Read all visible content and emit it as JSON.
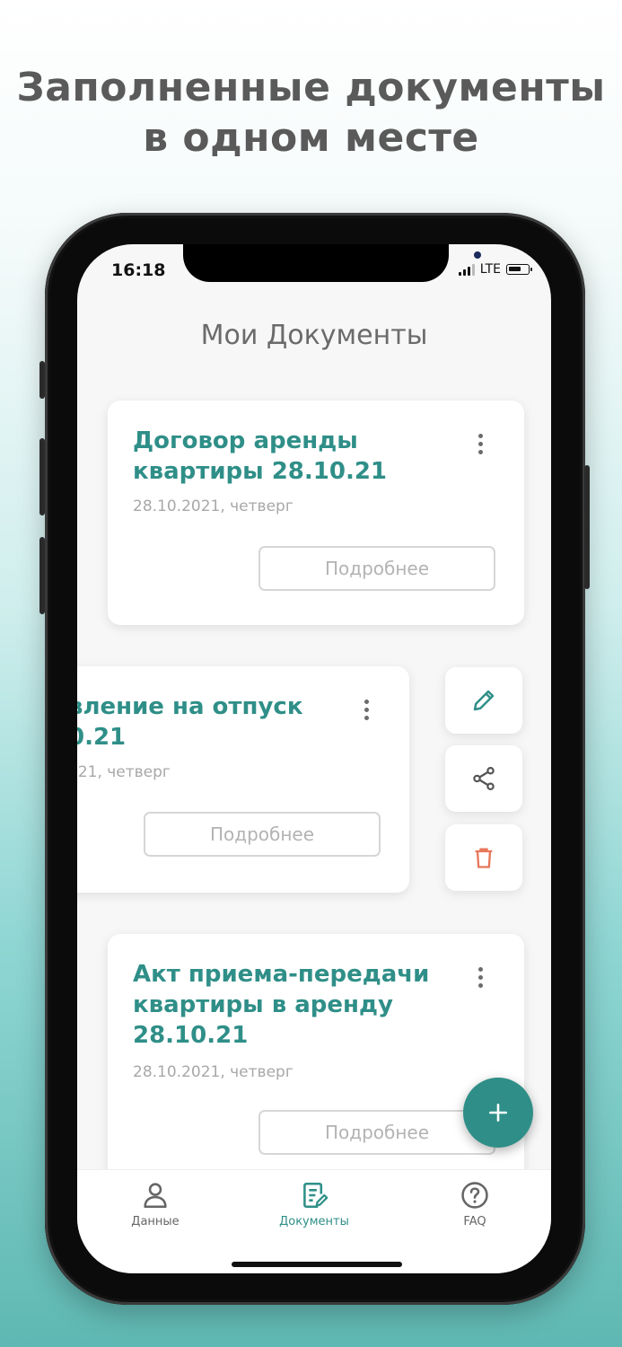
{
  "headline": {
    "line1": "Заполненные документы",
    "line2": "в одном месте"
  },
  "status_bar": {
    "time": "16:18",
    "network": "LTE"
  },
  "page_title": "Мои Документы",
  "documents": [
    {
      "title_line1": "Договор аренды",
      "title_line2": "квартиры 28.10.21",
      "date": "28.10.2021, четверг",
      "button": "Подробнее"
    },
    {
      "title_line1": "вление на отпуск",
      "title_line2": "0.21",
      "date": "021, четверг",
      "button": "Подробнее"
    },
    {
      "title_line1": "Акт приема-передачи",
      "title_line2": "квартиры в аренду",
      "title_line3": "28.10.21",
      "date": "28.10.2021, четверг",
      "button": "Подробнее"
    }
  ],
  "swipe_actions": {
    "icons": [
      "pencil-icon",
      "share-icon",
      "trash-icon"
    ],
    "delete_color": "#e8775a"
  },
  "fab": {
    "icon": "plus-icon"
  },
  "tabbar": {
    "items": [
      {
        "label": "Данные",
        "icon": "person-icon"
      },
      {
        "label": "Документы",
        "icon": "document-edit-icon"
      },
      {
        "label": "FAQ",
        "icon": "question-icon"
      }
    ],
    "active_label": "Документы"
  },
  "colors": {
    "accent": "#2f8f88",
    "title_gray": "#6b6b6b",
    "date_gray": "#a8a8a8"
  }
}
